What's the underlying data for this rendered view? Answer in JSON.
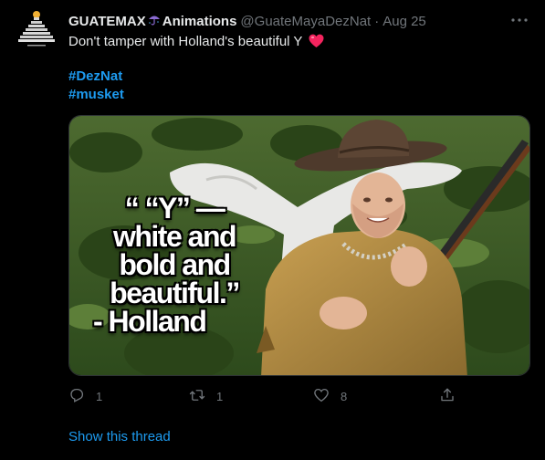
{
  "tweet": {
    "display_name": "GUATEMAX",
    "display_name_suffix": "Animations",
    "handle": "@GuateMayaDezNat",
    "separator": "·",
    "date": "Aug 25",
    "text": "Don't tamper with Holland's beautiful Y",
    "hashtags": [
      "#DezNat",
      "#musket"
    ],
    "media": {
      "caption_lines": [
        "“ “Y” —",
        "white and",
        "bold and",
        "beautiful.”"
      ],
      "caption_author": "- Holland"
    },
    "actions": {
      "reply_count": "1",
      "retweet_count": "1",
      "like_count": "8"
    },
    "show_thread": "Show this thread"
  },
  "colors": {
    "background": "#000000",
    "text": "#e7e9ea",
    "muted": "#71767b",
    "accent": "#1d9bf0",
    "heart": "#f4245e"
  },
  "icons": {
    "more": "more-horizontal-icon",
    "reply": "reply-icon",
    "retweet": "retweet-icon",
    "like": "like-icon",
    "share": "share-icon"
  }
}
